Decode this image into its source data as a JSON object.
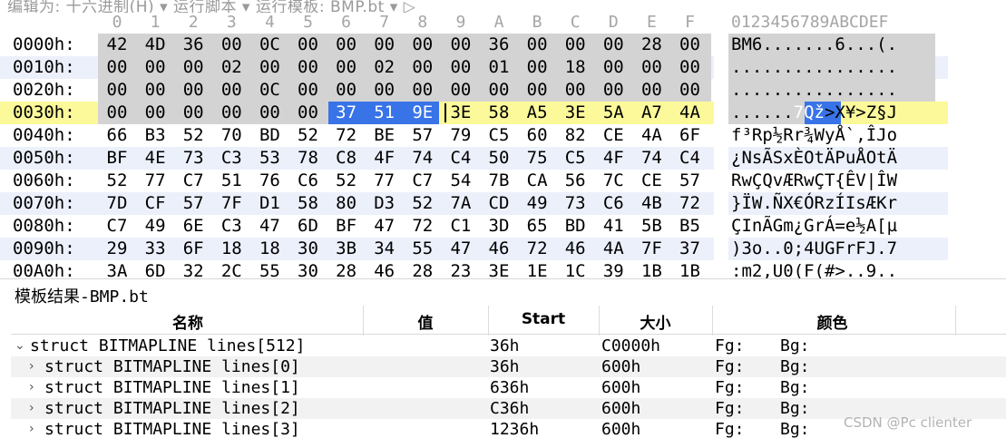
{
  "menu": {
    "text": "编辑为: 十六进制(H) ▾   运行脚本 ▾   运行模板: BMP.bt ▾  ▷"
  },
  "hex_editor": {
    "column_digits": [
      "0",
      "1",
      "2",
      "3",
      "4",
      "5",
      "6",
      "7",
      "8",
      "9",
      "A",
      "B",
      "C",
      "D",
      "E",
      "F"
    ],
    "ascii_header": "0123456789ABCDEF",
    "rows": [
      {
        "address": "0000h:",
        "bytes": [
          "42",
          "4D",
          "36",
          "00",
          "0C",
          "00",
          "00",
          "00",
          "00",
          "00",
          "36",
          "00",
          "00",
          "00",
          "28",
          "00"
        ],
        "ascii": "BM6.......6...(."
      },
      {
        "address": "0010h:",
        "bytes": [
          "00",
          "00",
          "00",
          "02",
          "00",
          "00",
          "00",
          "02",
          "00",
          "00",
          "01",
          "00",
          "18",
          "00",
          "00",
          "00"
        ],
        "ascii": "................"
      },
      {
        "address": "0020h:",
        "bytes": [
          "00",
          "00",
          "00",
          "00",
          "0C",
          "00",
          "00",
          "00",
          "00",
          "00",
          "00",
          "00",
          "00",
          "00",
          "00",
          "00"
        ],
        "ascii": "................"
      },
      {
        "address": "0030h:",
        "bytes": [
          "00",
          "00",
          "00",
          "00",
          "00",
          "00",
          "37",
          "51",
          "9E",
          "3E",
          "58",
          "A5",
          "3E",
          "5A",
          "A7",
          "4A"
        ],
        "ascii": "......7Qž>X¥>Z§J"
      },
      {
        "address": "0040h:",
        "bytes": [
          "66",
          "B3",
          "52",
          "70",
          "BD",
          "52",
          "72",
          "BE",
          "57",
          "79",
          "C5",
          "60",
          "82",
          "CE",
          "4A",
          "6F"
        ],
        "ascii": "f³Rp½Rr¾WyÅ`‚ÎJo"
      },
      {
        "address": "0050h:",
        "bytes": [
          "BF",
          "4E",
          "73",
          "C3",
          "53",
          "78",
          "C8",
          "4F",
          "74",
          "C4",
          "50",
          "75",
          "C5",
          "4F",
          "74",
          "C4"
        ],
        "ascii": "¿NsÃSxÈOtÄPuÅOtÄ"
      },
      {
        "address": "0060h:",
        "bytes": [
          "52",
          "77",
          "C7",
          "51",
          "76",
          "C6",
          "52",
          "77",
          "C7",
          "54",
          "7B",
          "CA",
          "56",
          "7C",
          "CE",
          "57"
        ],
        "ascii": "RwÇQvÆRwÇT{ÊV|ÎW"
      },
      {
        "address": "0070h:",
        "bytes": [
          "7D",
          "CF",
          "57",
          "7F",
          "D1",
          "58",
          "80",
          "D3",
          "52",
          "7A",
          "CD",
          "49",
          "73",
          "C6",
          "4B",
          "72"
        ],
        "ascii": "}ÏW.ÑX€ÓRzÍIsÆKr"
      },
      {
        "address": "0080h:",
        "bytes": [
          "C7",
          "49",
          "6E",
          "C3",
          "47",
          "6D",
          "BF",
          "47",
          "72",
          "C1",
          "3D",
          "65",
          "BD",
          "41",
          "5B",
          "B5"
        ],
        "ascii": "ÇInÃGm¿GrÁ=e½A[µ"
      },
      {
        "address": "0090h:",
        "bytes": [
          "29",
          "33",
          "6F",
          "18",
          "18",
          "30",
          "3B",
          "34",
          "55",
          "47",
          "46",
          "72",
          "46",
          "4A",
          "7F",
          "37"
        ],
        "ascii": ")3o..0;4UGFrFJ.7"
      },
      {
        "address": "00A0h:",
        "bytes": [
          "3A",
          "6D",
          "32",
          "2C",
          "55",
          "30",
          "28",
          "46",
          "28",
          "23",
          "3E",
          "1E",
          "1C",
          "39",
          "1B",
          "1B"
        ],
        "ascii": ":m2,U0(F(#>..9.."
      }
    ]
  },
  "template_panel": {
    "title": "模板结果-BMP.bt",
    "columns": {
      "name": "名称",
      "value": "值",
      "start": "Start",
      "size": "大小",
      "color": "颜色"
    },
    "rows": [
      {
        "name": "struct BITMAPLINE lines[512]",
        "value": "",
        "start": "36h",
        "size": "C0000h",
        "fg": "Fg:",
        "bg": "Bg:",
        "expander": "⌄",
        "level": 0
      },
      {
        "name": "struct BITMAPLINE lines[0]",
        "value": "",
        "start": "36h",
        "size": "600h",
        "fg": "Fg:",
        "bg": "Bg:",
        "expander": "›",
        "level": 1
      },
      {
        "name": "struct BITMAPLINE lines[1]",
        "value": "",
        "start": "636h",
        "size": "600h",
        "fg": "Fg:",
        "bg": "Bg:",
        "expander": "›",
        "level": 1
      },
      {
        "name": "struct BITMAPLINE lines[2]",
        "value": "",
        "start": "C36h",
        "size": "600h",
        "fg": "Fg:",
        "bg": "Bg:",
        "expander": "›",
        "level": 1
      },
      {
        "name": "struct BITMAPLINE lines[3]",
        "value": "",
        "start": "1236h",
        "size": "600h",
        "fg": "Fg:",
        "bg": "Bg:",
        "expander": "›",
        "level": 1
      }
    ]
  },
  "watermark": "CSDN @Pc clienter",
  "colors": {
    "selection": "#3873e8",
    "cursor_row": "#fbf99a",
    "alt_row": "#ecf0fb",
    "header_grey": "#d3d3d3"
  }
}
